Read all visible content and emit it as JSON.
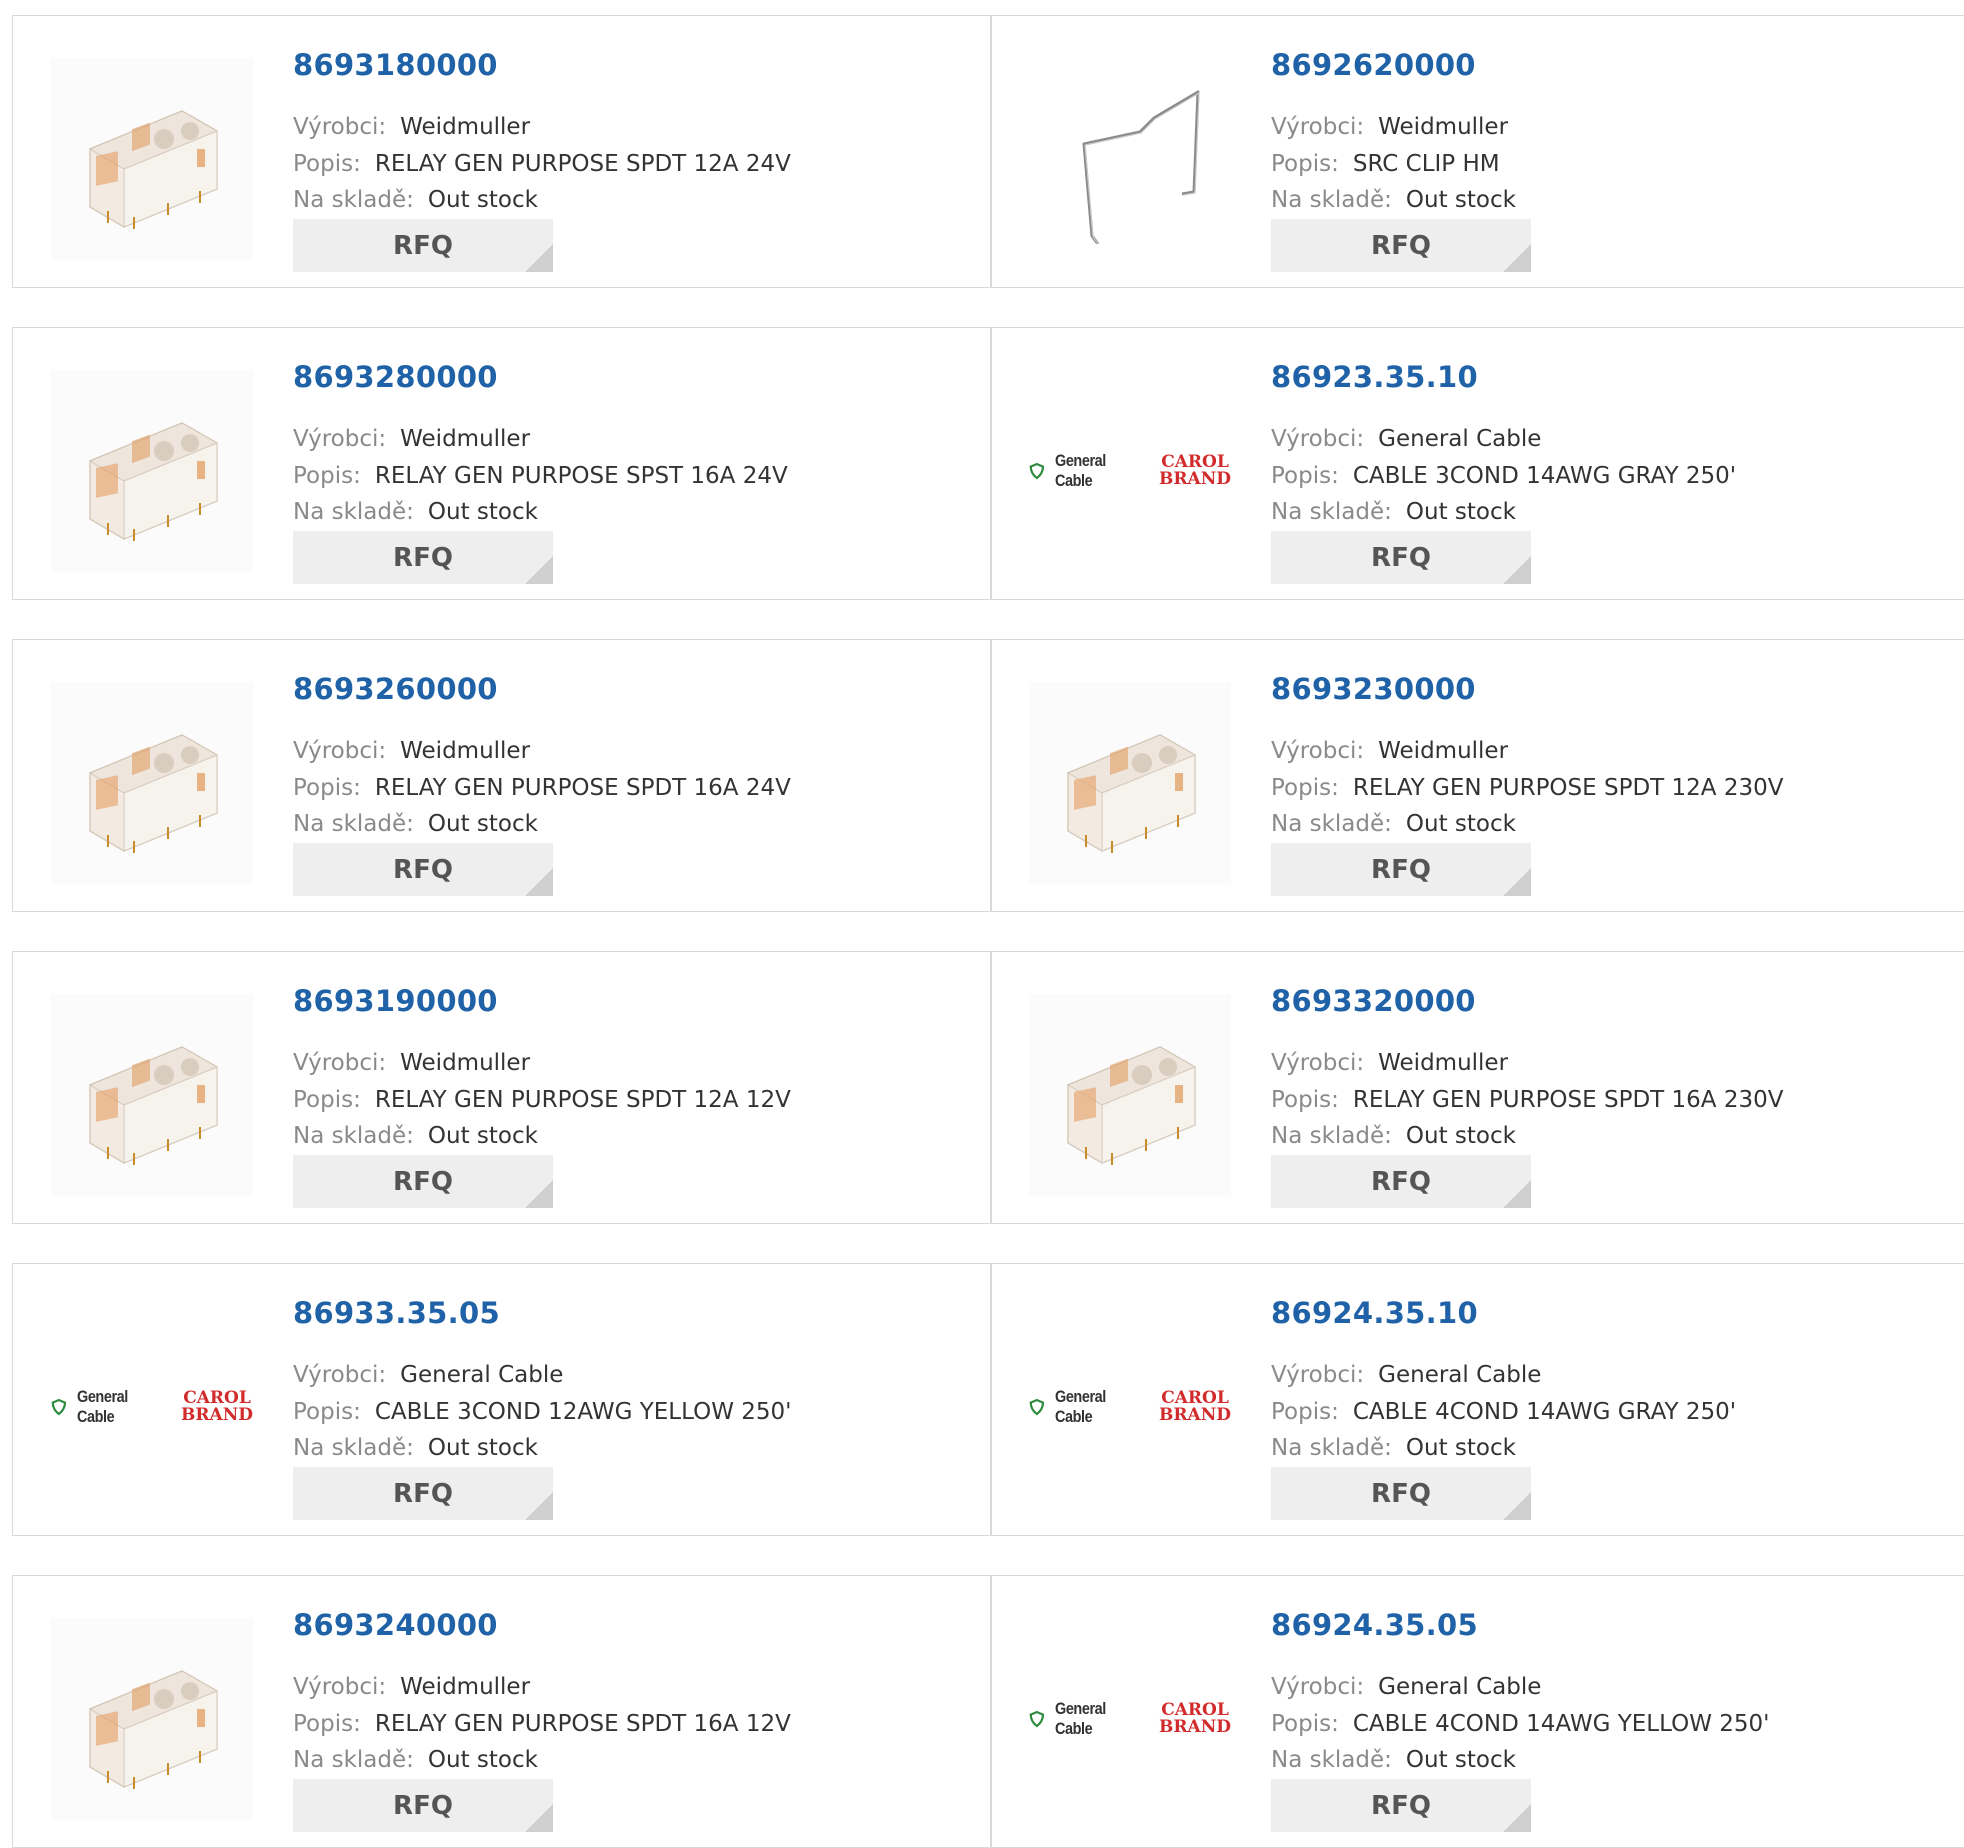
{
  "labels": {
    "manufacturer": "Výrobci:",
    "description": "Popis:",
    "stock": "Na skladě:",
    "rfq": "RFQ"
  },
  "brand": {
    "general_cable": "General Cable",
    "carol_1": "CAROL",
    "carol_2": "BRAND"
  },
  "colors": {
    "part_number": "#1f62a8",
    "border": "#d9d9d9",
    "button_bg": "#eeeeee",
    "carol_red": "#d22b2b",
    "shield_green": "#2e8b3d"
  },
  "products": [
    {
      "part": "8693180000",
      "manufacturer": "Weidmuller",
      "description": "RELAY GEN PURPOSE SPDT 12A 24V",
      "stock": "Out stock",
      "image": "relay-image"
    },
    {
      "part": "8692620000",
      "manufacturer": "Weidmuller",
      "description": "SRC CLIP HM",
      "stock": "Out stock",
      "image": "clip-image"
    },
    {
      "part": "8693280000",
      "manufacturer": "Weidmuller",
      "description": "RELAY GEN PURPOSE SPST 16A 24V",
      "stock": "Out stock",
      "image": "relay-image"
    },
    {
      "part": "86923.35.10",
      "manufacturer": "General Cable",
      "description": "CABLE 3COND 14AWG GRAY 250'",
      "stock": "Out stock",
      "image": "general-cable-logo"
    },
    {
      "part": "8693260000",
      "manufacturer": "Weidmuller",
      "description": "RELAY GEN PURPOSE SPDT 16A 24V",
      "stock": "Out stock",
      "image": "relay-image"
    },
    {
      "part": "8693230000",
      "manufacturer": "Weidmuller",
      "description": "RELAY GEN PURPOSE SPDT 12A 230V",
      "stock": "Out stock",
      "image": "relay-image"
    },
    {
      "part": "8693190000",
      "manufacturer": "Weidmuller",
      "description": "RELAY GEN PURPOSE SPDT 12A 12V",
      "stock": "Out stock",
      "image": "relay-image"
    },
    {
      "part": "8693320000",
      "manufacturer": "Weidmuller",
      "description": "RELAY GEN PURPOSE SPDT 16A 230V",
      "stock": "Out stock",
      "image": "relay-image"
    },
    {
      "part": "86933.35.05",
      "manufacturer": "General Cable",
      "description": "CABLE 3COND 12AWG YELLOW 250'",
      "stock": "Out stock",
      "image": "general-cable-logo"
    },
    {
      "part": "86924.35.10",
      "manufacturer": "General Cable",
      "description": "CABLE 4COND 14AWG GRAY 250'",
      "stock": "Out stock",
      "image": "general-cable-logo"
    },
    {
      "part": "8693240000",
      "manufacturer": "Weidmuller",
      "description": "RELAY GEN PURPOSE SPDT 16A 12V",
      "stock": "Out stock",
      "image": "relay-image"
    },
    {
      "part": "86924.35.05",
      "manufacturer": "General Cable",
      "description": "CABLE 4COND 14AWG YELLOW 250'",
      "stock": "Out stock",
      "image": "general-cable-logo"
    }
  ]
}
